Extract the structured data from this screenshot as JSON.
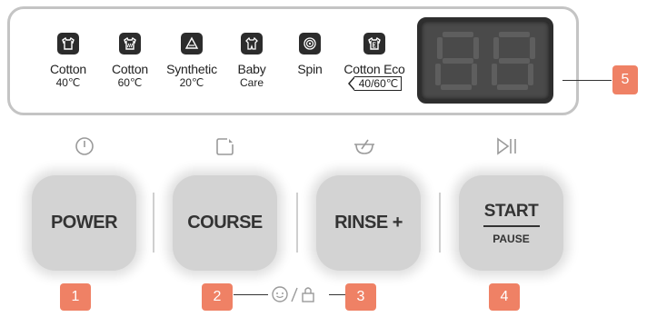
{
  "courses": [
    {
      "line1": "Cotton",
      "line2": "40℃",
      "icon": "shirt-icon"
    },
    {
      "line1": "Cotton",
      "line2": "60℃",
      "icon": "shirt-steam-icon"
    },
    {
      "line1": "Synthetic",
      "line2": "20℃",
      "icon": "recycle-triangle-icon"
    },
    {
      "line1": "Baby",
      "line2": "Care",
      "icon": "baby-shirt-icon"
    },
    {
      "line1": "Spin",
      "line2": "",
      "icon": "spiral-icon"
    },
    {
      "line1": "Cotton Eco",
      "line2": "40/60℃",
      "icon": "eco-shirt-icon"
    }
  ],
  "display": {
    "readout": "88"
  },
  "callouts": {
    "c1": "1",
    "c2": "2",
    "c3": "3",
    "c4": "4",
    "c5": "5"
  },
  "buttons": {
    "power": "POWER",
    "course": "COURSE",
    "rinse": "RINSE +",
    "start": "START",
    "pause": "PAUSE"
  },
  "colors": {
    "callout": "#ef8165",
    "button": "#d3d3d3",
    "display": "#4a4a4a"
  }
}
